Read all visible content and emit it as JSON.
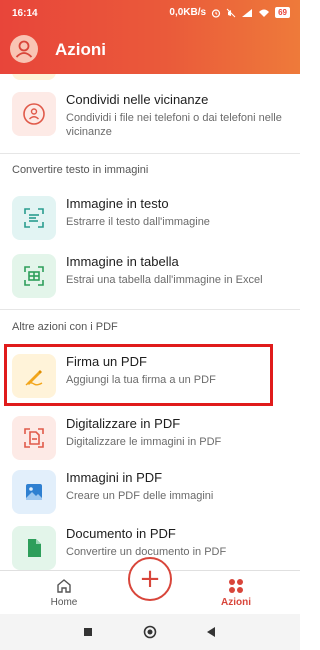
{
  "status_bar": {
    "time": "16:14",
    "network_speed": "0,0KB/s",
    "battery": "69"
  },
  "app_bar": {
    "title": "Azioni"
  },
  "items": [
    {
      "title": "Condividi nelle vicinanze",
      "subtitle": "Condividi i file nei telefoni o dai telefoni nelle vicinanze",
      "icon": "nearby-share-icon"
    },
    {
      "title": "Immagine in testo",
      "subtitle": "Estrarre il testo dall'immagine",
      "icon": "image-to-text-icon"
    },
    {
      "title": "Immagine in tabella",
      "subtitle": "Estrai una tabella dall'immagine in Excel",
      "icon": "image-to-table-icon"
    },
    {
      "title": "Firma un PDF",
      "subtitle": "Aggiungi la tua firma a un PDF",
      "icon": "pen-icon"
    },
    {
      "title": "Digitalizzare in PDF",
      "subtitle": "Digitalizzare le immagini in PDF",
      "icon": "scan-pdf-icon"
    },
    {
      "title": "Immagini in PDF",
      "subtitle": "Creare un PDF delle immagini",
      "icon": "image-icon"
    },
    {
      "title": "Documento in PDF",
      "subtitle": "Convertire un documento in PDF",
      "icon": "document-icon"
    }
  ],
  "sections": {
    "convert_text": "Convertire testo in immagini",
    "other_pdf": "Altre azioni con i PDF"
  },
  "bottom_nav": {
    "home": "Home",
    "actions": "Azioni",
    "fab": "+"
  },
  "colors": {
    "accent": "#d8453a",
    "header_start": "#e8453a",
    "header_end": "#ee7a3a",
    "highlight_border": "#e01b1b"
  }
}
